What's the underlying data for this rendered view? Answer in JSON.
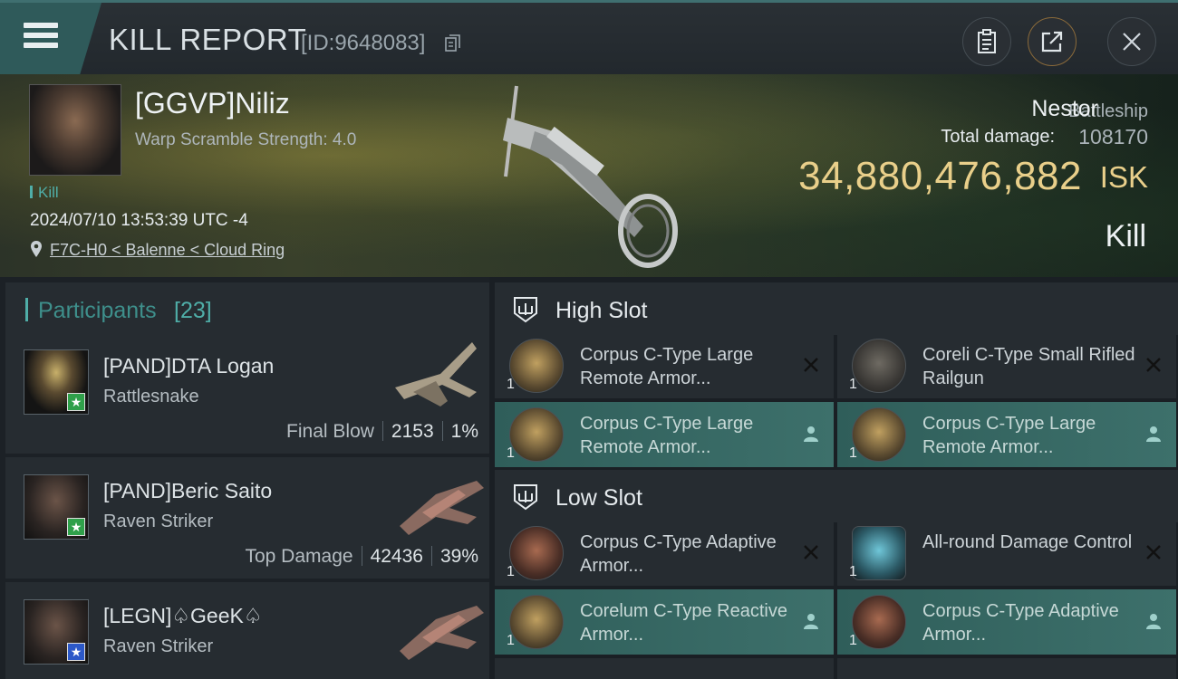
{
  "header": {
    "title": "KILL REPORT",
    "report_id": "[ID:9648083]"
  },
  "victim": {
    "name": "[GGVP]Niliz",
    "warp_scramble": "Warp Scramble Strength: 4.0",
    "tag": "Kill",
    "datetime": "2024/07/10 13:53:39 UTC -4",
    "location": "F7C-H0 < Balenne < Cloud Ring",
    "ship_name": "Nestor",
    "ship_class": "Battleship",
    "total_damage_label": "Total damage:",
    "total_damage": "108170",
    "isk_value": "34,880,476,882",
    "isk_unit": "ISK",
    "result": "Kill"
  },
  "participants": {
    "title": "Participants",
    "count": "[23]",
    "rows": [
      {
        "name": "[PAND]DTA Logan",
        "ship": "Rattlesnake",
        "label": "Final Blow",
        "damage": "2153",
        "percent": "1%",
        "badge": "★"
      },
      {
        "name": "[PAND]Beric Saito",
        "ship": "Raven Striker",
        "label": "Top Damage",
        "damage": "42436",
        "percent": "39%",
        "badge": "★"
      },
      {
        "name": "[LEGN]♤GeeK♤",
        "ship": "Raven Striker",
        "label": "",
        "damage": "",
        "percent": "",
        "badge": "★"
      }
    ]
  },
  "slots": {
    "high_title": "High Slot",
    "low_title": "Low Slot",
    "high": [
      {
        "name": "Corpus C-Type Large Remote Armor...",
        "qty": "1",
        "status": "destroyed-icon"
      },
      {
        "name": "Coreli C-Type Small Rifled Railgun",
        "qty": "1",
        "status": "destroyed-icon"
      },
      {
        "name": "Corpus C-Type Large Remote Armor...",
        "qty": "1",
        "status": "dropped-icon"
      },
      {
        "name": "Corpus C-Type Large Remote Armor...",
        "qty": "1",
        "status": "dropped-icon"
      }
    ],
    "low": [
      {
        "name": "Corpus C-Type Adaptive Armor...",
        "qty": "1",
        "status": "destroyed-icon"
      },
      {
        "name": "All-round Damage Control",
        "qty": "1",
        "status": "destroyed-icon"
      },
      {
        "name": "Corelum C-Type Reactive Armor...",
        "qty": "1",
        "status": "dropped-icon"
      },
      {
        "name": "Corpus C-Type Adaptive Armor...",
        "qty": "1",
        "status": "dropped-icon"
      }
    ]
  },
  "colors": {
    "accent": "#4faea8",
    "isk": "#e9cf8a",
    "dropped_row": "#3d706b",
    "panel": "#262c31"
  }
}
